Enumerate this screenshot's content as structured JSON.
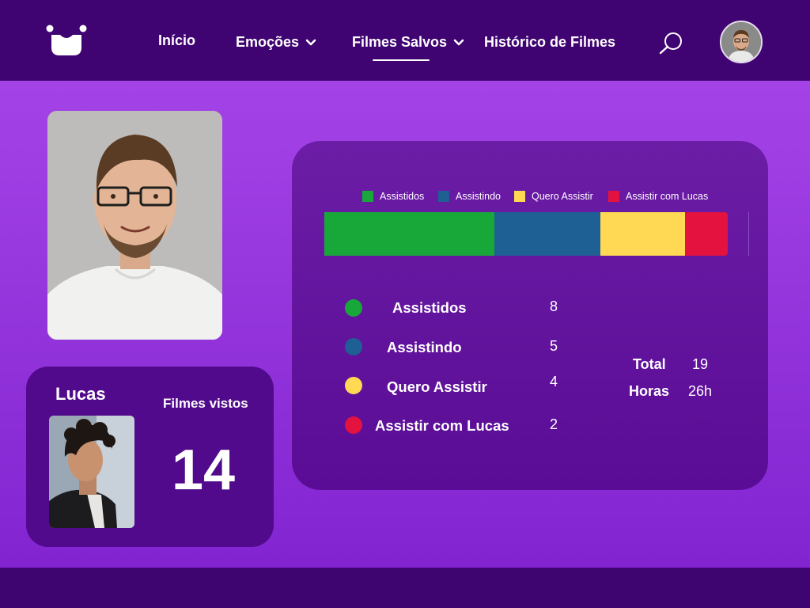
{
  "nav": {
    "items": [
      {
        "label": "Início"
      },
      {
        "label": "Emoções"
      },
      {
        "label": "Filmes Salvos"
      },
      {
        "label": "Histórico de Filmes"
      }
    ],
    "logo_icon": "smiling-face-logo-icon",
    "search_icon": "search-icon"
  },
  "friend": {
    "name": "Lucas",
    "films_label": "Filmes vistos",
    "films_count": "14"
  },
  "stats": {
    "categories": [
      {
        "label": "Assistidos",
        "legend": "Assistidos",
        "value": "8",
        "color": "#18a83a"
      },
      {
        "label": "Assistindo",
        "legend": "Assistindo",
        "value": "5",
        "color": "#1e5f94"
      },
      {
        "label": "Quero Assistir",
        "legend": "Quero Assistir",
        "value": "4",
        "color": "#ffd954"
      },
      {
        "label": "Assistir com Lucas",
        "legend": "Assistir com Lucas",
        "value": "2",
        "color": "#e3123e"
      }
    ],
    "total_label": "Total",
    "total_value": "19",
    "hours_label": "Horas",
    "hours_value": "26h"
  },
  "chart_data": {
    "type": "bar",
    "orientation": "horizontal-stacked",
    "categories": [
      "Assistidos",
      "Assistindo",
      "Quero Assistir",
      "Assistir com Lucas"
    ],
    "values": [
      8,
      5,
      4,
      2
    ],
    "colors": [
      "#18a83a",
      "#1e5f94",
      "#ffd954",
      "#e3123e"
    ],
    "legend": "top",
    "grid": false
  },
  "colors": {
    "header": "#3f0471",
    "background_top": "#a948ea",
    "card": "#500a8b"
  }
}
